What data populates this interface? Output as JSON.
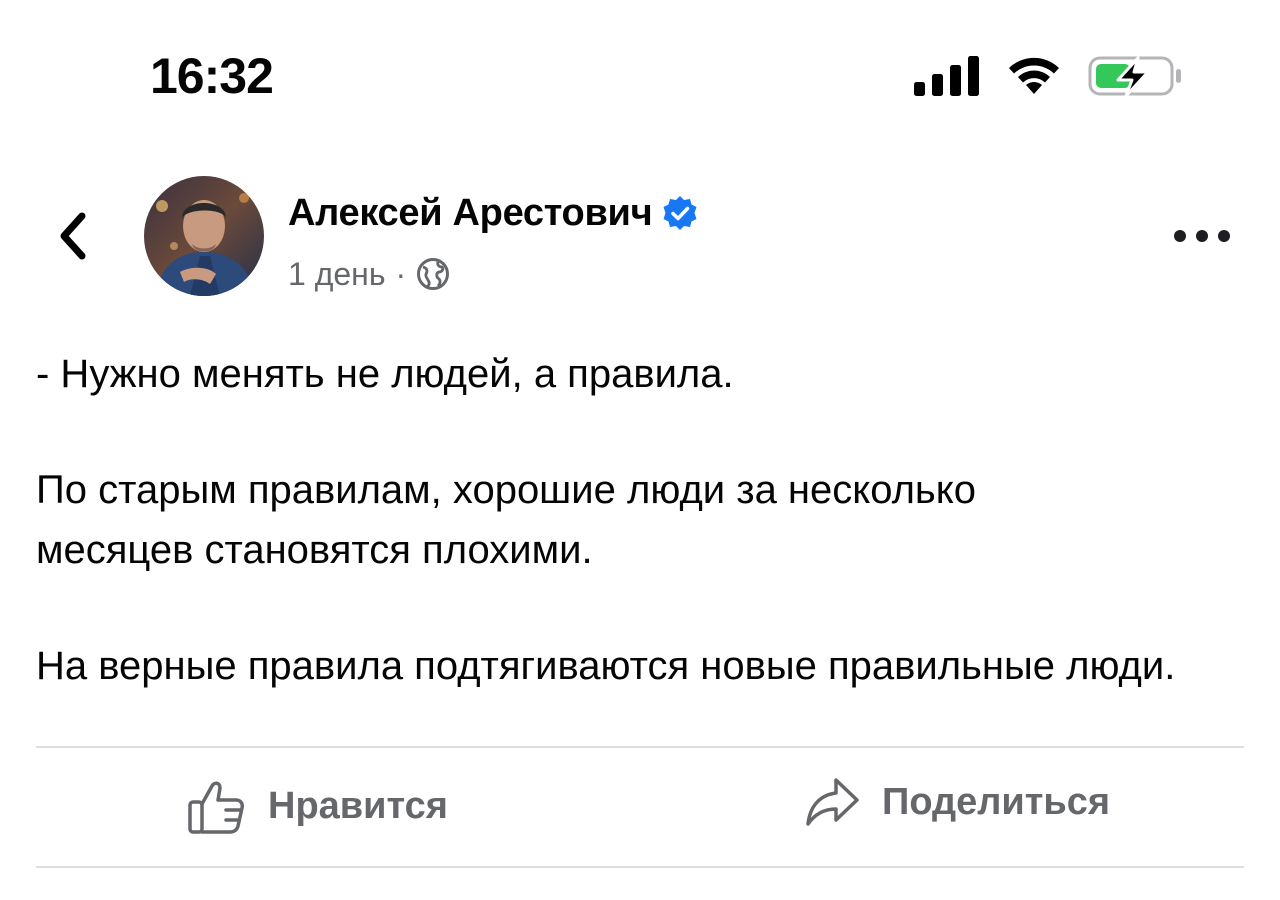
{
  "status_bar": {
    "time": "16:32",
    "icons": [
      "signal-icon",
      "wifi-icon",
      "battery-charging-icon"
    ]
  },
  "post": {
    "author": {
      "name": "Алексей Арестович",
      "verified": true
    },
    "time_ago": "1 день",
    "separator": "·",
    "audience_icon": "globe-icon",
    "paragraphs": [
      "- Нужно менять не людей, а правила.",
      "По старым правилам, хорошие люди за несколько месяцев становятся плохими.",
      "На верные правила подтягиваются новые правильные люди."
    ]
  },
  "actions": {
    "like_label": "Нравится",
    "share_label": "Поделиться"
  },
  "colors": {
    "verified_blue": "#1877f2",
    "secondary_text": "#65676b",
    "battery_green": "#34c759"
  }
}
